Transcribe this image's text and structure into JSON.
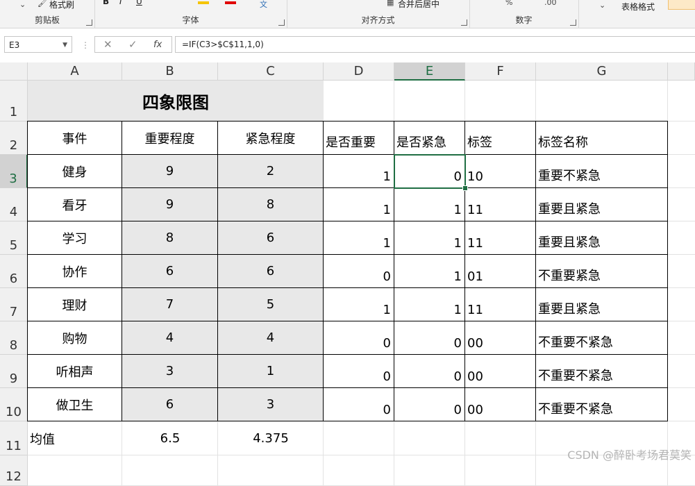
{
  "ribbon": {
    "groups": [
      {
        "id": "clipboard",
        "label": "剪贴板"
      },
      {
        "id": "font",
        "label": "字体"
      },
      {
        "id": "align",
        "label": "对齐方式"
      },
      {
        "id": "number",
        "label": "数字"
      }
    ],
    "format_painter": "格式刷",
    "merge_center": "合并后居中",
    "table_format": "表格格式",
    "font_glyphs": [
      "B",
      "I",
      "U"
    ]
  },
  "formula_bar": {
    "name_box": "E3",
    "formula": "=IF(C3>$C$11,1,0)",
    "cancel_icon": "✕",
    "enter_icon": "✓",
    "fx_label": "fx"
  },
  "columns": [
    "A",
    "B",
    "C",
    "D",
    "E",
    "F",
    "G"
  ],
  "rows": [
    "1",
    "2",
    "3",
    "4",
    "5",
    "6",
    "7",
    "8",
    "9",
    "10",
    "11",
    "12"
  ],
  "sheet": {
    "title": "四象限图",
    "headers": [
      "事件",
      "重要程度",
      "紧急程度",
      "是否重要",
      "是否紧急",
      "标签",
      "标签名称"
    ],
    "data": [
      [
        "健身",
        "9",
        "2",
        "1",
        "0",
        "10",
        "重要不紧急"
      ],
      [
        "看牙",
        "9",
        "8",
        "1",
        "1",
        "11",
        "重要且紧急"
      ],
      [
        "学习",
        "8",
        "6",
        "1",
        "1",
        "11",
        "重要且紧急"
      ],
      [
        "协作",
        "6",
        "6",
        "0",
        "1",
        "01",
        "不重要紧急"
      ],
      [
        "理财",
        "7",
        "5",
        "1",
        "1",
        "11",
        "重要且紧急"
      ],
      [
        "购物",
        "4",
        "4",
        "0",
        "0",
        "00",
        "不重要不紧急"
      ],
      [
        "听相声",
        "3",
        "1",
        "0",
        "0",
        "00",
        "不重要不紧急"
      ],
      [
        "做卫生",
        "6",
        "3",
        "0",
        "0",
        "00",
        "不重要不紧急"
      ]
    ],
    "avg_label": "均值",
    "avg_b": "6.5",
    "avg_c": "4.375"
  },
  "watermark": "CSDN @醉卧考场君莫笑",
  "colors": {
    "selection": "#1f6e43",
    "header_bg": "#f0f0f0",
    "grey_fill": "#e8e8e8"
  }
}
